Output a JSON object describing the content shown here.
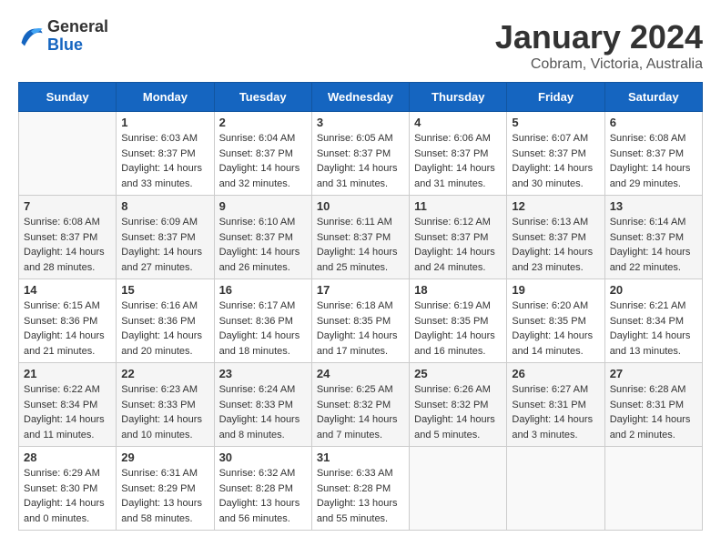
{
  "header": {
    "logo": {
      "general": "General",
      "blue": "Blue"
    },
    "title": "January 2024",
    "location": "Cobram, Victoria, Australia"
  },
  "weekdays": [
    "Sunday",
    "Monday",
    "Tuesday",
    "Wednesday",
    "Thursday",
    "Friday",
    "Saturday"
  ],
  "weeks": [
    [
      {
        "num": "",
        "sunrise": "",
        "sunset": "",
        "daylight": ""
      },
      {
        "num": "1",
        "sunrise": "Sunrise: 6:03 AM",
        "sunset": "Sunset: 8:37 PM",
        "daylight": "Daylight: 14 hours and 33 minutes."
      },
      {
        "num": "2",
        "sunrise": "Sunrise: 6:04 AM",
        "sunset": "Sunset: 8:37 PM",
        "daylight": "Daylight: 14 hours and 32 minutes."
      },
      {
        "num": "3",
        "sunrise": "Sunrise: 6:05 AM",
        "sunset": "Sunset: 8:37 PM",
        "daylight": "Daylight: 14 hours and 31 minutes."
      },
      {
        "num": "4",
        "sunrise": "Sunrise: 6:06 AM",
        "sunset": "Sunset: 8:37 PM",
        "daylight": "Daylight: 14 hours and 31 minutes."
      },
      {
        "num": "5",
        "sunrise": "Sunrise: 6:07 AM",
        "sunset": "Sunset: 8:37 PM",
        "daylight": "Daylight: 14 hours and 30 minutes."
      },
      {
        "num": "6",
        "sunrise": "Sunrise: 6:08 AM",
        "sunset": "Sunset: 8:37 PM",
        "daylight": "Daylight: 14 hours and 29 minutes."
      }
    ],
    [
      {
        "num": "7",
        "sunrise": "Sunrise: 6:08 AM",
        "sunset": "Sunset: 8:37 PM",
        "daylight": "Daylight: 14 hours and 28 minutes."
      },
      {
        "num": "8",
        "sunrise": "Sunrise: 6:09 AM",
        "sunset": "Sunset: 8:37 PM",
        "daylight": "Daylight: 14 hours and 27 minutes."
      },
      {
        "num": "9",
        "sunrise": "Sunrise: 6:10 AM",
        "sunset": "Sunset: 8:37 PM",
        "daylight": "Daylight: 14 hours and 26 minutes."
      },
      {
        "num": "10",
        "sunrise": "Sunrise: 6:11 AM",
        "sunset": "Sunset: 8:37 PM",
        "daylight": "Daylight: 14 hours and 25 minutes."
      },
      {
        "num": "11",
        "sunrise": "Sunrise: 6:12 AM",
        "sunset": "Sunset: 8:37 PM",
        "daylight": "Daylight: 14 hours and 24 minutes."
      },
      {
        "num": "12",
        "sunrise": "Sunrise: 6:13 AM",
        "sunset": "Sunset: 8:37 PM",
        "daylight": "Daylight: 14 hours and 23 minutes."
      },
      {
        "num": "13",
        "sunrise": "Sunrise: 6:14 AM",
        "sunset": "Sunset: 8:37 PM",
        "daylight": "Daylight: 14 hours and 22 minutes."
      }
    ],
    [
      {
        "num": "14",
        "sunrise": "Sunrise: 6:15 AM",
        "sunset": "Sunset: 8:36 PM",
        "daylight": "Daylight: 14 hours and 21 minutes."
      },
      {
        "num": "15",
        "sunrise": "Sunrise: 6:16 AM",
        "sunset": "Sunset: 8:36 PM",
        "daylight": "Daylight: 14 hours and 20 minutes."
      },
      {
        "num": "16",
        "sunrise": "Sunrise: 6:17 AM",
        "sunset": "Sunset: 8:36 PM",
        "daylight": "Daylight: 14 hours and 18 minutes."
      },
      {
        "num": "17",
        "sunrise": "Sunrise: 6:18 AM",
        "sunset": "Sunset: 8:35 PM",
        "daylight": "Daylight: 14 hours and 17 minutes."
      },
      {
        "num": "18",
        "sunrise": "Sunrise: 6:19 AM",
        "sunset": "Sunset: 8:35 PM",
        "daylight": "Daylight: 14 hours and 16 minutes."
      },
      {
        "num": "19",
        "sunrise": "Sunrise: 6:20 AM",
        "sunset": "Sunset: 8:35 PM",
        "daylight": "Daylight: 14 hours and 14 minutes."
      },
      {
        "num": "20",
        "sunrise": "Sunrise: 6:21 AM",
        "sunset": "Sunset: 8:34 PM",
        "daylight": "Daylight: 14 hours and 13 minutes."
      }
    ],
    [
      {
        "num": "21",
        "sunrise": "Sunrise: 6:22 AM",
        "sunset": "Sunset: 8:34 PM",
        "daylight": "Daylight: 14 hours and 11 minutes."
      },
      {
        "num": "22",
        "sunrise": "Sunrise: 6:23 AM",
        "sunset": "Sunset: 8:33 PM",
        "daylight": "Daylight: 14 hours and 10 minutes."
      },
      {
        "num": "23",
        "sunrise": "Sunrise: 6:24 AM",
        "sunset": "Sunset: 8:33 PM",
        "daylight": "Daylight: 14 hours and 8 minutes."
      },
      {
        "num": "24",
        "sunrise": "Sunrise: 6:25 AM",
        "sunset": "Sunset: 8:32 PM",
        "daylight": "Daylight: 14 hours and 7 minutes."
      },
      {
        "num": "25",
        "sunrise": "Sunrise: 6:26 AM",
        "sunset": "Sunset: 8:32 PM",
        "daylight": "Daylight: 14 hours and 5 minutes."
      },
      {
        "num": "26",
        "sunrise": "Sunrise: 6:27 AM",
        "sunset": "Sunset: 8:31 PM",
        "daylight": "Daylight: 14 hours and 3 minutes."
      },
      {
        "num": "27",
        "sunrise": "Sunrise: 6:28 AM",
        "sunset": "Sunset: 8:31 PM",
        "daylight": "Daylight: 14 hours and 2 minutes."
      }
    ],
    [
      {
        "num": "28",
        "sunrise": "Sunrise: 6:29 AM",
        "sunset": "Sunset: 8:30 PM",
        "daylight": "Daylight: 14 hours and 0 minutes."
      },
      {
        "num": "29",
        "sunrise": "Sunrise: 6:31 AM",
        "sunset": "Sunset: 8:29 PM",
        "daylight": "Daylight: 13 hours and 58 minutes."
      },
      {
        "num": "30",
        "sunrise": "Sunrise: 6:32 AM",
        "sunset": "Sunset: 8:28 PM",
        "daylight": "Daylight: 13 hours and 56 minutes."
      },
      {
        "num": "31",
        "sunrise": "Sunrise: 6:33 AM",
        "sunset": "Sunset: 8:28 PM",
        "daylight": "Daylight: 13 hours and 55 minutes."
      },
      {
        "num": "",
        "sunrise": "",
        "sunset": "",
        "daylight": ""
      },
      {
        "num": "",
        "sunrise": "",
        "sunset": "",
        "daylight": ""
      },
      {
        "num": "",
        "sunrise": "",
        "sunset": "",
        "daylight": ""
      }
    ]
  ]
}
